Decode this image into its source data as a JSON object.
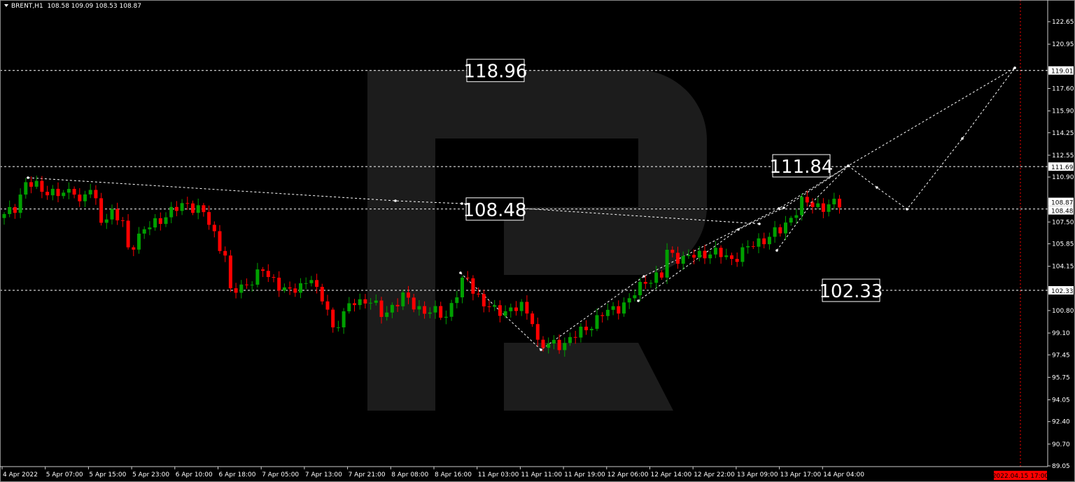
{
  "header": {
    "symbol": "BRENT,H1",
    "ohlc": "108.58 109.09 108.53 108.87"
  },
  "colors": {
    "background": "#000000",
    "bull": "#00a000",
    "bear": "#ff0000",
    "grid_line": "#ffffff",
    "watermark": "#1c1c1c",
    "current_time_marker": "#ff0000"
  },
  "chart_data": {
    "type": "candlestick",
    "title": "BRENT,H1",
    "ylim": [
      89.05,
      122.65
    ],
    "bar_count": 156,
    "close_waypoints": [
      [
        0,
        107.9
      ],
      [
        2,
        108.68
      ],
      [
        4,
        110.43
      ],
      [
        7,
        110.0
      ],
      [
        11,
        109.48
      ],
      [
        13,
        110.11
      ],
      [
        14,
        108.95
      ],
      [
        16,
        110.0
      ],
      [
        18,
        107.78
      ],
      [
        20,
        108.15
      ],
      [
        22,
        107.36
      ],
      [
        23,
        105.51
      ],
      [
        26,
        106.83
      ],
      [
        29,
        107.78
      ],
      [
        34,
        108.95
      ],
      [
        37,
        108.15
      ],
      [
        39,
        106.57
      ],
      [
        41,
        104.98
      ],
      [
        42,
        102.07
      ],
      [
        45,
        102.86
      ],
      [
        48,
        103.76
      ],
      [
        50,
        103.13
      ],
      [
        53,
        102.07
      ],
      [
        57,
        103.39
      ],
      [
        58,
        102.07
      ],
      [
        60,
        101.01
      ],
      [
        61,
        99.42
      ],
      [
        65,
        101.54
      ],
      [
        68,
        101.54
      ],
      [
        70,
        100.48
      ],
      [
        74,
        101.8
      ],
      [
        78,
        100.75
      ],
      [
        82,
        100.48
      ],
      [
        85,
        102.86
      ],
      [
        86,
        103.13
      ],
      [
        89,
        101.27
      ],
      [
        91,
        100.75
      ],
      [
        96,
        101.01
      ],
      [
        98,
        100.22
      ],
      [
        99,
        98.37
      ],
      [
        100,
        98.1
      ],
      [
        104,
        98.37
      ],
      [
        107,
        99.16
      ],
      [
        111,
        100.48
      ],
      [
        116,
        101.54
      ],
      [
        119,
        103.13
      ],
      [
        122,
        103.39
      ],
      [
        123,
        105.24
      ],
      [
        126,
        104.71
      ],
      [
        131,
        105.24
      ],
      [
        135,
        104.71
      ],
      [
        140,
        106.04
      ],
      [
        144,
        106.83
      ],
      [
        146,
        107.89
      ],
      [
        148,
        108.95
      ],
      [
        152,
        108.68
      ],
      [
        155,
        108.87
      ]
    ],
    "y_ticks": [
      "122.65",
      "120.95",
      "117.60",
      "115.90",
      "114.25",
      "112.55",
      "110.90",
      "107.50",
      "105.85",
      "104.15",
      "100.80",
      "99.10",
      "97.45",
      "95.75",
      "94.05",
      "92.40",
      "90.70",
      "89.05"
    ],
    "x_ticks": [
      "4 Apr 2022",
      "5 Apr 07:00",
      "5 Apr 15:00",
      "5 Apr 23:00",
      "6 Apr 10:00",
      "6 Apr 18:00",
      "7 Apr 05:00",
      "7 Apr 13:00",
      "7 Apr 21:00",
      "8 Apr 08:00",
      "8 Apr 16:00",
      "11 Apr 03:00",
      "11 Apr 11:00",
      "11 Apr 19:00",
      "12 Apr 06:00",
      "12 Apr 14:00",
      "12 Apr 22:00",
      "13 Apr 09:00",
      "13 Apr 17:00",
      "14 Apr 04:00"
    ],
    "levels": [
      {
        "label": "118.96",
        "axis_label": "119.01",
        "price": 118.96
      },
      {
        "label": "111.84",
        "axis_label": "111.69",
        "price": 111.69
      },
      {
        "label": "108.48",
        "axis_label": "108.48",
        "price": 108.48
      },
      {
        "label": "102.33",
        "axis_label": "102.33",
        "price": 102.33
      }
    ],
    "current_price_label": "108.87",
    "current_price": 108.87,
    "time_marker_label": "2022.04.15 17:00"
  }
}
